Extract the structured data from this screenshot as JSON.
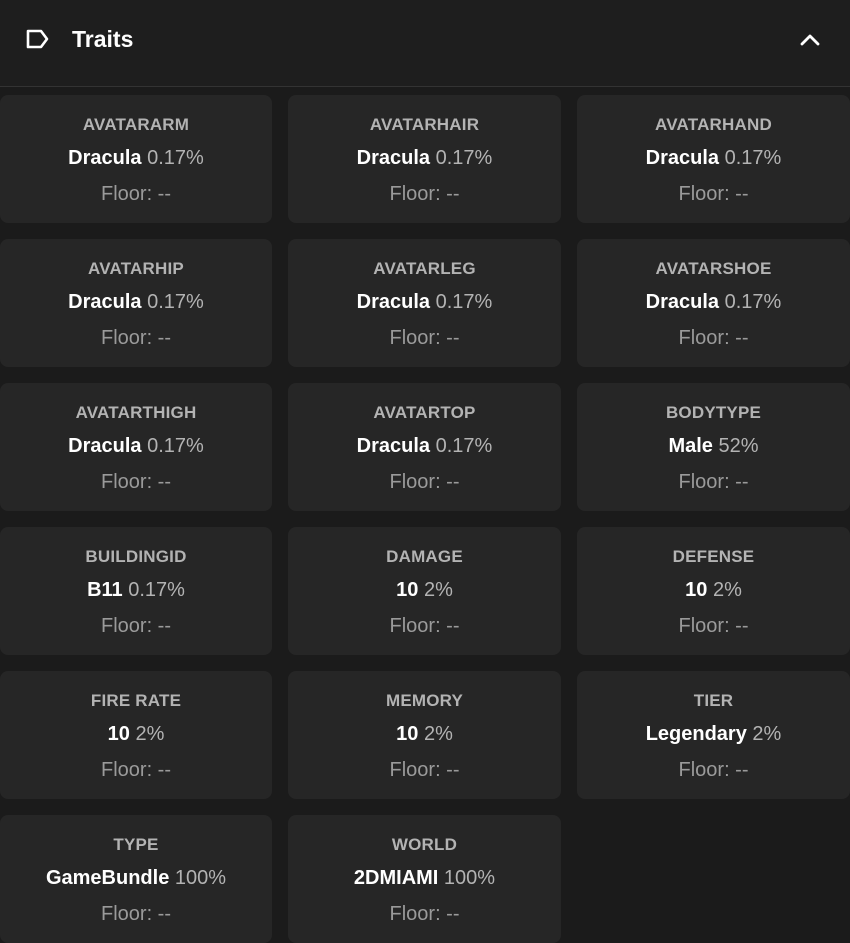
{
  "header": {
    "title": "Traits",
    "icon": "tag-icon",
    "toggle_icon": "chevron-up-icon"
  },
  "colors": {
    "background": "#1b1b1b",
    "card": "#262626",
    "label": "#b3b3b3",
    "value": "#ffffff",
    "floor": "#9a9a9a"
  },
  "traits": [
    {
      "type": "AVATARARM",
      "value": "Dracula",
      "percent": "0.17%",
      "floor": "Floor: --"
    },
    {
      "type": "AVATARHAIR",
      "value": "Dracula",
      "percent": "0.17%",
      "floor": "Floor: --"
    },
    {
      "type": "AVATARHAND",
      "value": "Dracula",
      "percent": "0.17%",
      "floor": "Floor: --"
    },
    {
      "type": "AVATARHIP",
      "value": "Dracula",
      "percent": "0.17%",
      "floor": "Floor: --"
    },
    {
      "type": "AVATARLEG",
      "value": "Dracula",
      "percent": "0.17%",
      "floor": "Floor: --"
    },
    {
      "type": "AVATARSHOE",
      "value": "Dracula",
      "percent": "0.17%",
      "floor": "Floor: --"
    },
    {
      "type": "AVATARTHIGH",
      "value": "Dracula",
      "percent": "0.17%",
      "floor": "Floor: --"
    },
    {
      "type": "AVATARTOP",
      "value": "Dracula",
      "percent": "0.17%",
      "floor": "Floor: --"
    },
    {
      "type": "BODYTYPE",
      "value": "Male",
      "percent": "52%",
      "floor": "Floor: --"
    },
    {
      "type": "BUILDINGID",
      "value": "B11",
      "percent": "0.17%",
      "floor": "Floor: --"
    },
    {
      "type": "DAMAGE",
      "value": "10",
      "percent": "2%",
      "floor": "Floor: --"
    },
    {
      "type": "DEFENSE",
      "value": "10",
      "percent": "2%",
      "floor": "Floor: --"
    },
    {
      "type": "FIRE RATE",
      "value": "10",
      "percent": "2%",
      "floor": "Floor: --"
    },
    {
      "type": "MEMORY",
      "value": "10",
      "percent": "2%",
      "floor": "Floor: --"
    },
    {
      "type": "TIER",
      "value": "Legendary",
      "percent": "2%",
      "floor": "Floor: --"
    },
    {
      "type": "TYPE",
      "value": "GameBundle",
      "percent": "100%",
      "floor": "Floor: --"
    },
    {
      "type": "WORLD",
      "value": "2DMIAMI",
      "percent": "100%",
      "floor": "Floor: --"
    }
  ]
}
